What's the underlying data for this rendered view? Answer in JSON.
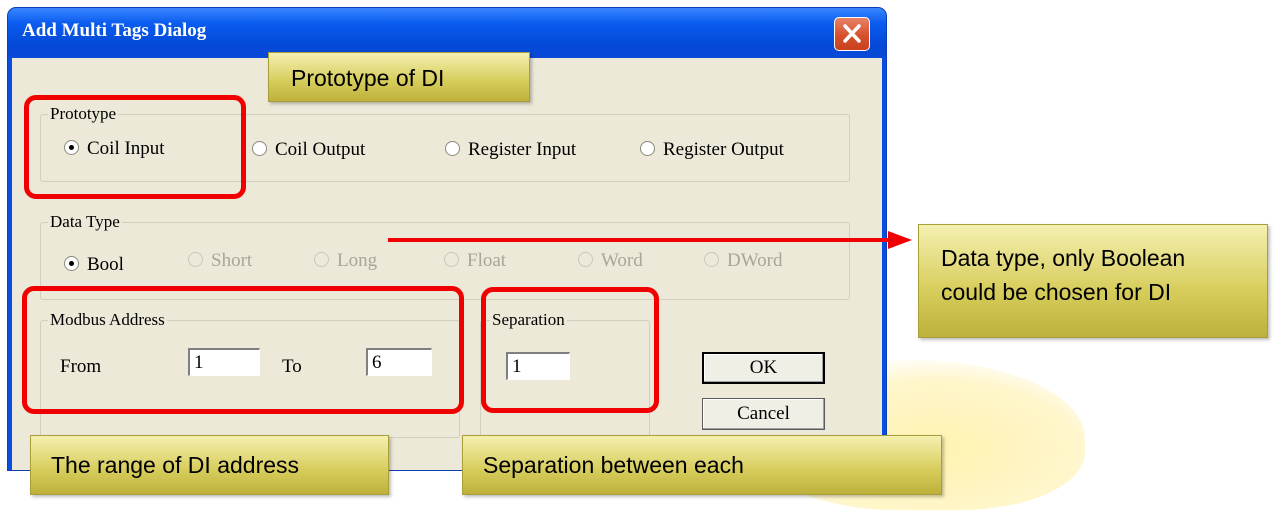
{
  "dialog": {
    "title": "Add Multi Tags Dialog",
    "prototype": {
      "label": "Prototype",
      "options": [
        "Coil Input",
        "Coil Output",
        "Register Input",
        "Register Output"
      ],
      "selected": "Coil Input"
    },
    "data_type": {
      "label": "Data Type",
      "options": [
        "Bool",
        "Short",
        "Long",
        "Float",
        "Word",
        "DWord"
      ],
      "selected": "Bool"
    },
    "modbus_address": {
      "label": "Modbus Address",
      "from_label": "From",
      "from_value": "1",
      "to_label": "To",
      "to_value": "6"
    },
    "separation": {
      "label": "Separation",
      "value": "1"
    },
    "ok_label": "OK",
    "cancel_label": "Cancel"
  },
  "callouts": {
    "prototype": "Prototype of DI",
    "data_type_line1": "Data type, only Boolean",
    "data_type_line2": "could be chosen for DI",
    "range": "The range of DI address",
    "separation": "Separation between each"
  },
  "colors": {
    "highlight": "#f10000",
    "callout": "#d6cc5a",
    "title_bar": "#0a4ee0"
  }
}
